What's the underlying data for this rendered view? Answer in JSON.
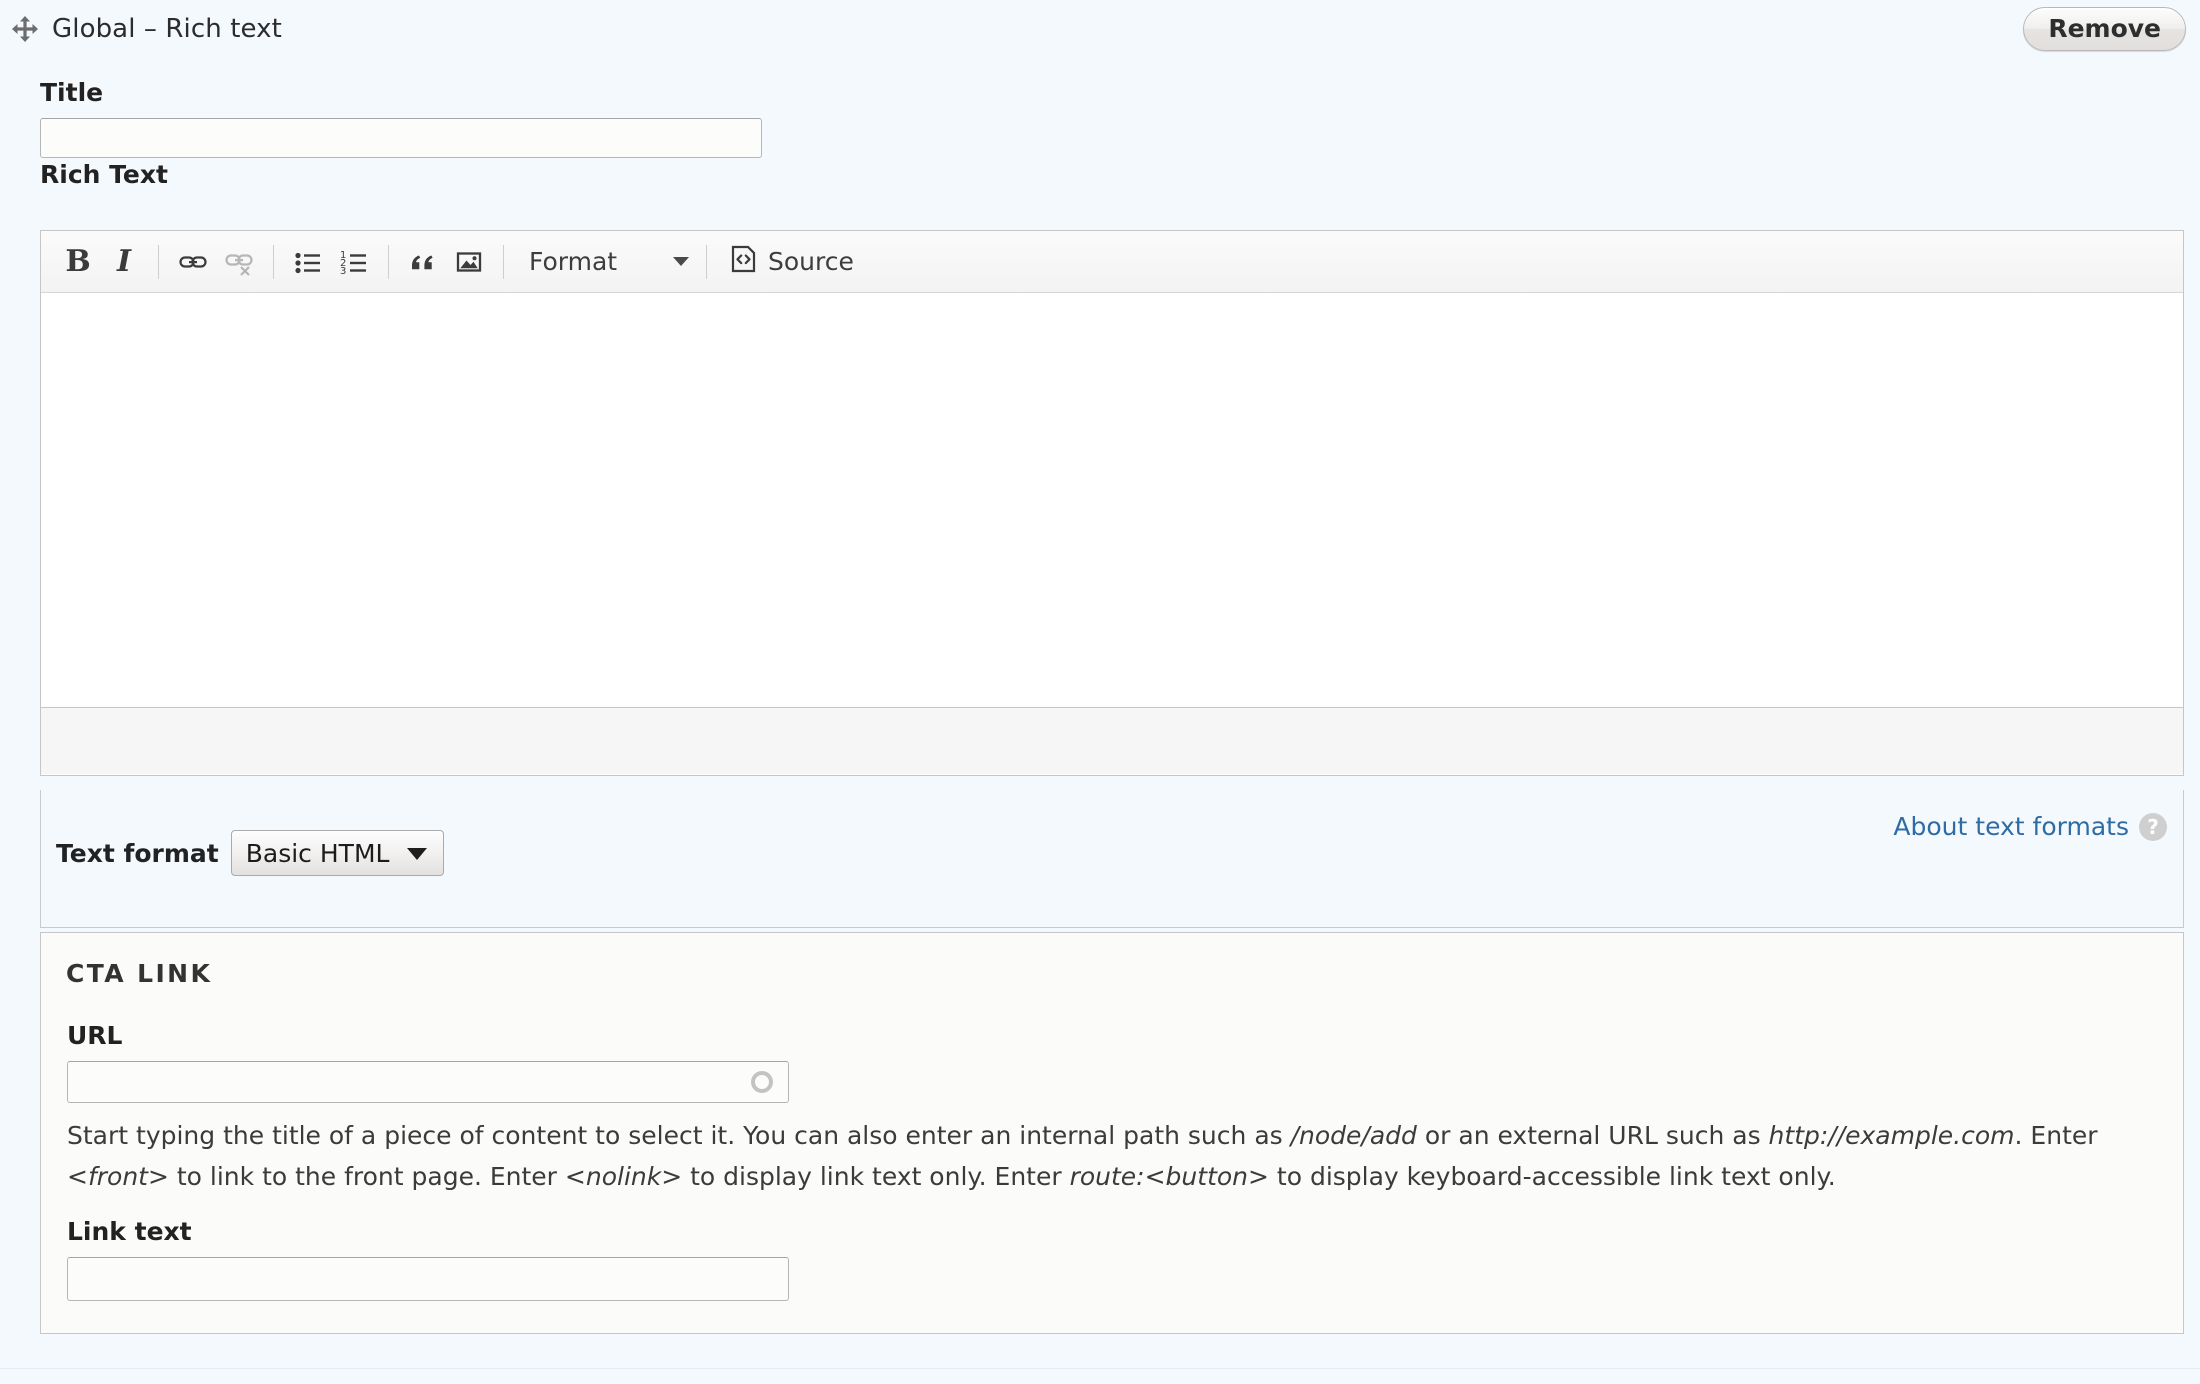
{
  "header": {
    "drag_icon": "move-icon",
    "title": "Global – Rich text",
    "remove_label": "Remove"
  },
  "fields": {
    "title": {
      "label": "Title",
      "value": "",
      "placeholder": ""
    },
    "rich_text": {
      "label": "Rich Text",
      "value": "",
      "toolbar": [
        {
          "name": "bold",
          "label": "B",
          "icon": "bold-icon",
          "disabled": false
        },
        {
          "name": "italic",
          "label": "I",
          "icon": "italic-icon",
          "disabled": false
        },
        {
          "name": "link",
          "label": "Link",
          "icon": "link-icon",
          "disabled": false
        },
        {
          "name": "unlink",
          "label": "Unlink",
          "icon": "unlink-icon",
          "disabled": true
        },
        {
          "name": "bulleted-list",
          "label": "Insert/Remove Bulleted List",
          "icon": "bulleted-list-icon",
          "disabled": false
        },
        {
          "name": "numbered-list",
          "label": "Insert/Remove Numbered List",
          "icon": "numbered-list-icon",
          "disabled": false
        },
        {
          "name": "blockquote",
          "label": "Block Quote",
          "icon": "blockquote-icon",
          "disabled": false
        },
        {
          "name": "image",
          "label": "Image",
          "icon": "image-icon",
          "disabled": false
        }
      ],
      "format_dropdown_label": "Format",
      "source_label": "Source",
      "source_icon": "source-code-icon"
    },
    "text_format": {
      "label": "Text format",
      "selected": "Basic HTML",
      "options": [
        "Basic HTML"
      ],
      "about_link": "About text formats",
      "help_icon_glyph": "?"
    }
  },
  "cta": {
    "legend": "CTA LINK",
    "url": {
      "label": "URL",
      "value": "",
      "placeholder": "",
      "throbber_icon": "autocomplete-throbber-icon"
    },
    "help_segments": [
      {
        "text": "Start typing the title of a piece of content to select it. You can also enter an internal path such as ",
        "italic": false
      },
      {
        "text": "/node/add",
        "italic": true
      },
      {
        "text": " or an external URL such as ",
        "italic": false
      },
      {
        "text": "http://example.com",
        "italic": true
      },
      {
        "text": ". Enter ",
        "italic": false
      },
      {
        "text": "<front>",
        "italic": true
      },
      {
        "text": " to link to the front page. Enter ",
        "italic": false
      },
      {
        "text": "<nolink>",
        "italic": true
      },
      {
        "text": " to display link text only. Enter ",
        "italic": false
      },
      {
        "text": "route:<button>",
        "italic": true
      },
      {
        "text": " to display keyboard-accessible link text only.",
        "italic": false
      }
    ],
    "link_text": {
      "label": "Link text",
      "value": "",
      "placeholder": ""
    }
  },
  "colors": {
    "page_background": "#f4f9fe",
    "link": "#2e6ca5",
    "fieldset_background": "#fbfbf9",
    "toolbar_background": "#f4f4f4",
    "border": "#c6c6c6"
  }
}
